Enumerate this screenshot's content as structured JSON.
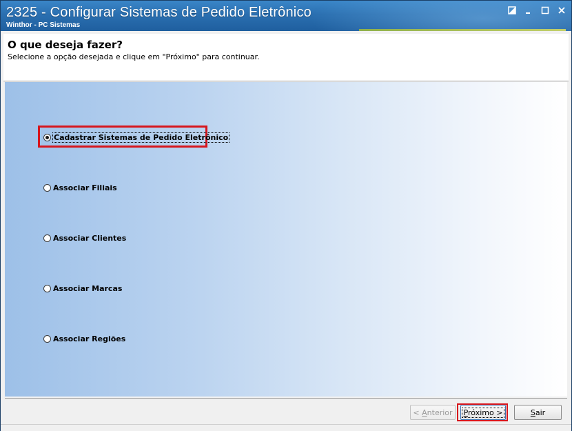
{
  "window": {
    "title": "2325 - Configurar Sistemas de Pedido Eletrônico",
    "subtitle": "Winthor - PC Sistemas",
    "controls": [
      "restore-icon",
      "minimize-icon",
      "maximize-icon",
      "close-icon"
    ]
  },
  "header": {
    "title": "O que deseja fazer?",
    "description": "Selecione a opção desejada e clique em \"Próximo\" para continuar."
  },
  "options": [
    {
      "label": "Cadastrar Sistemas de Pedido Eletrônico",
      "checked": true
    },
    {
      "label": "Associar Filiais",
      "checked": false
    },
    {
      "label": "Associar Clientes",
      "checked": false
    },
    {
      "label": "Associar Marcas",
      "checked": false
    },
    {
      "label": "Associar Regiões",
      "checked": false
    }
  ],
  "buttons": {
    "anterior": {
      "prefix": "< ",
      "mnemonic": "A",
      "rest": "nterior",
      "enabled": false
    },
    "proximo": {
      "mnemonic": "P",
      "rest": "róximo >",
      "enabled": true
    },
    "sair": {
      "mnemonic": "S",
      "rest": "air",
      "enabled": true
    }
  },
  "colors": {
    "titlebar": "#2a6fb0",
    "highlight": "#d7151c",
    "gradient_left": "#9dc0e8",
    "gradient_right": "#ffffff"
  }
}
